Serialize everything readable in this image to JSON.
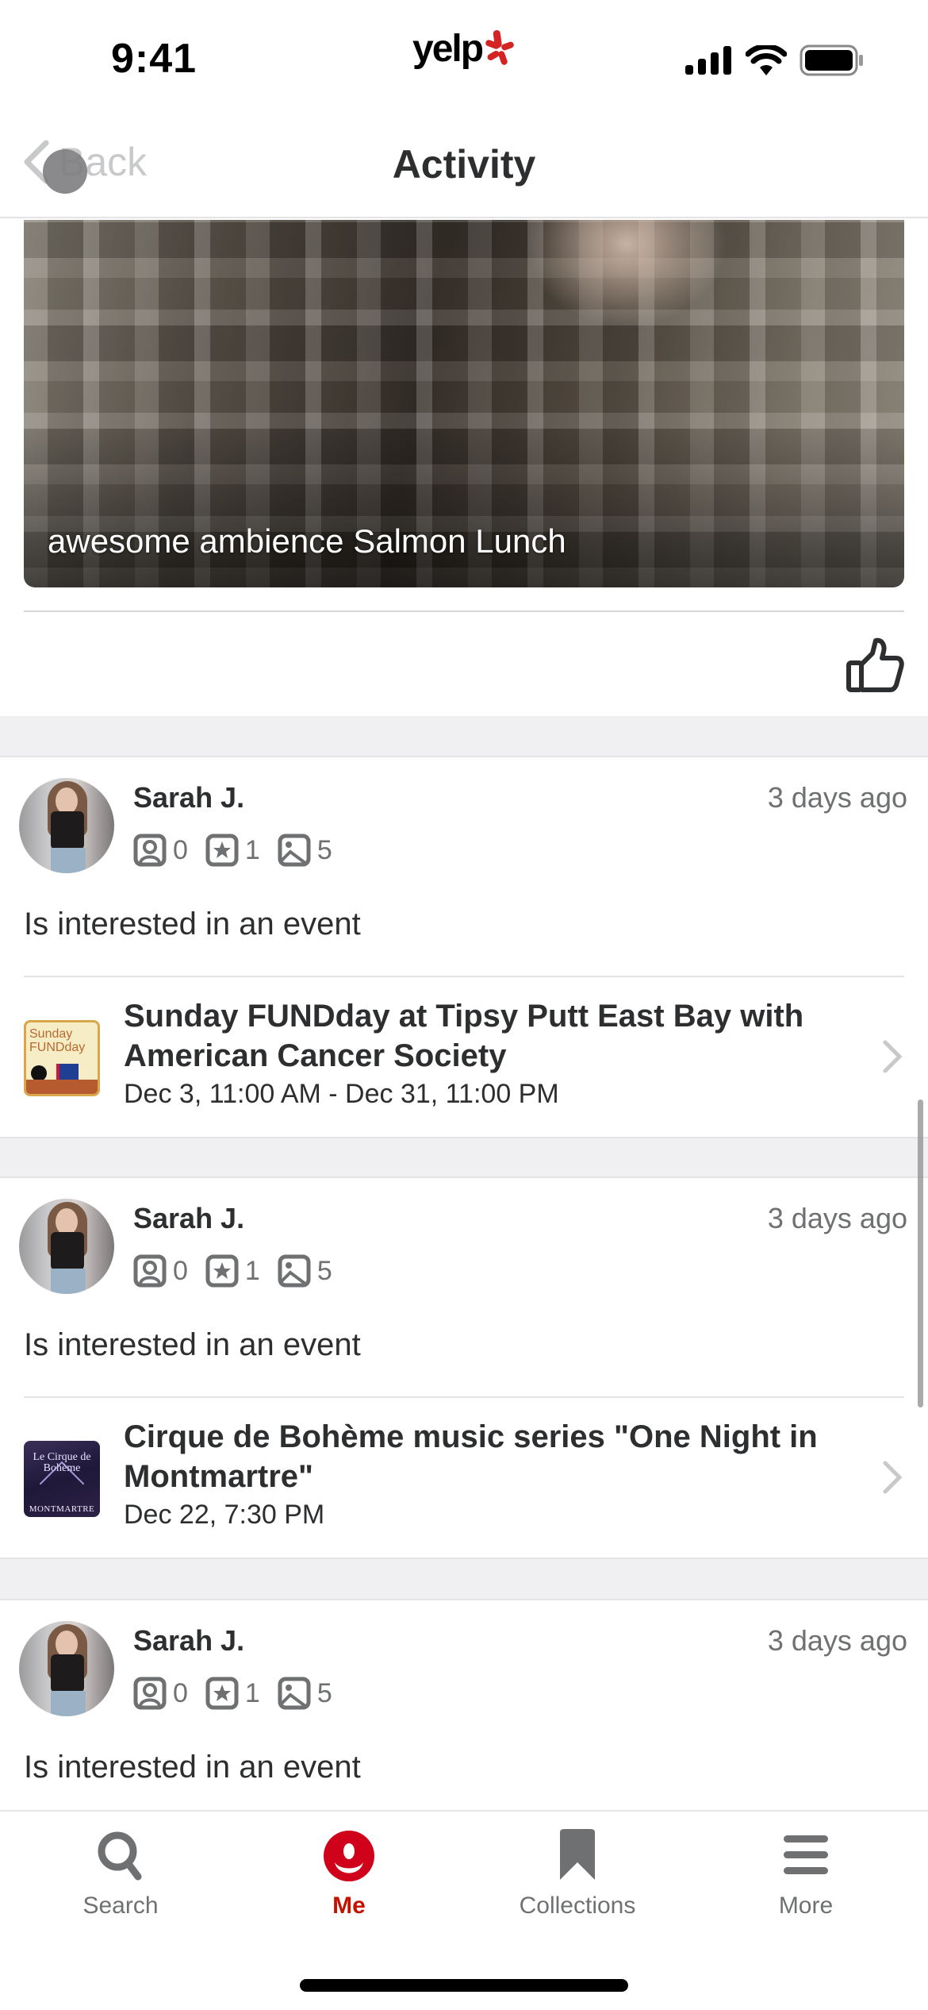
{
  "status_bar": {
    "time": "9:41",
    "logo_text": "yelp",
    "icons": [
      "cellular-signal-icon",
      "wifi-icon",
      "battery-icon"
    ]
  },
  "nav": {
    "back_label": "Back",
    "title": "Activity"
  },
  "photo_card": {
    "caption": "awesome ambience Salmon Lunch",
    "like_icon": "thumbs-up-icon"
  },
  "posts": [
    {
      "user_name": "Sarah J.",
      "time_ago": "3 days ago",
      "stats": {
        "friends": "0",
        "reviews": "1",
        "photos": "5"
      },
      "action": "Is interested in an event",
      "event": {
        "title": "Sunday FUNDday at Tipsy Putt East Bay with American Cancer Society",
        "date": "Dec 3, 11:00 AM - Dec 31, 11:00 PM",
        "thumb_text": "Sunday FUNDday"
      }
    },
    {
      "user_name": "Sarah J.",
      "time_ago": "3 days ago",
      "stats": {
        "friends": "0",
        "reviews": "1",
        "photos": "5"
      },
      "action": "Is interested in an event",
      "event": {
        "title": "Cirque de Bohème music series \"One Night in Montmartre\"",
        "date": "Dec 22, 7:30 PM",
        "thumb_text": "Le Cirque de Bohème",
        "thumb_subtext": "MONTMARTRE"
      }
    },
    {
      "user_name": "Sarah J.",
      "time_ago": "3 days ago",
      "stats": {
        "friends": "0",
        "reviews": "1",
        "photos": "5"
      },
      "action": "Is interested in an event"
    }
  ],
  "tab_bar": {
    "tabs": [
      {
        "label": "Search",
        "icon": "search-icon",
        "active": false
      },
      {
        "label": "Me",
        "icon": "me-icon",
        "active": true
      },
      {
        "label": "Collections",
        "icon": "bookmark-icon",
        "active": false
      },
      {
        "label": "More",
        "icon": "menu-icon",
        "active": false
      }
    ]
  },
  "colors": {
    "brand_red": "#d32323",
    "active_tab": "#c41200",
    "text_primary": "#2d2e2f",
    "text_secondary": "#6e7072",
    "separator_bg": "#f0f0f2"
  }
}
